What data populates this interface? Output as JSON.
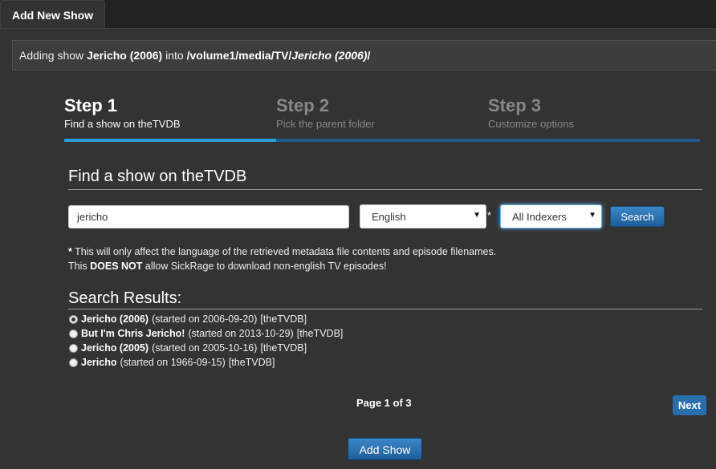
{
  "tabs": {
    "active_label": "Add New Show"
  },
  "adding": {
    "prefix": "Adding show",
    "show_name": "Jericho (2006)",
    "into": "into",
    "path_base": "/volume1/media/TV/",
    "path_show": "Jericho (2006)",
    "path_end": "/"
  },
  "steps": [
    {
      "title": "Step 1",
      "subtitle": "Find a show on theTVDB"
    },
    {
      "title": "Step 2",
      "subtitle": "Pick the parent folder"
    },
    {
      "title": "Step 3",
      "subtitle": "Customize options"
    }
  ],
  "find": {
    "section_title": "Find a show on theTVDB",
    "search_value": "jericho",
    "language_selected": "English",
    "asterisk": "*",
    "indexer_selected": "All Indexers",
    "search_button": "Search"
  },
  "note": {
    "star": "*",
    "line1": "This will only affect the language of the retrieved metadata file contents and episode filenames.",
    "line2_pre": "This",
    "line2_bold": "DOES NOT",
    "line2_post": "allow SickRage to download non-english TV episodes!"
  },
  "results": {
    "title": "Search Results:",
    "items": [
      {
        "name": "Jericho (2006)",
        "started": "(started on 2006-09-20)",
        "source": "[theTVDB]",
        "checked": true
      },
      {
        "name": "But I'm Chris Jericho!",
        "started": "(started on 2013-10-29)",
        "source": "[theTVDB]",
        "checked": false
      },
      {
        "name": "Jericho (2005)",
        "started": "(started on 2005-10-16)",
        "source": "[theTVDB]",
        "checked": false
      },
      {
        "name": "Jericho",
        "started": "(started on 1966-09-15)",
        "source": "[theTVDB]",
        "checked": false
      }
    ]
  },
  "pagination": {
    "text": "Page 1 of 3",
    "next_label": "Next"
  },
  "actions": {
    "add_show_label": "Add Show"
  },
  "colors": {
    "accent": "#29a0d6",
    "button": "#2a6ead",
    "background": "#333333"
  }
}
